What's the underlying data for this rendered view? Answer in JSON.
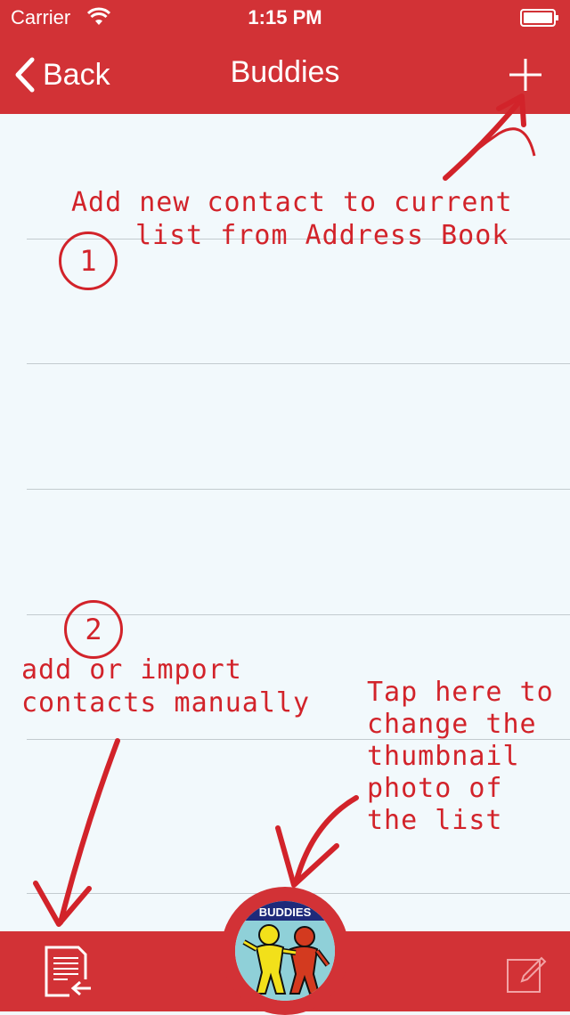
{
  "status_bar": {
    "carrier": "Carrier",
    "time": "1:15 PM"
  },
  "nav": {
    "back_label": "Back",
    "title": "Buddies"
  },
  "annotations": {
    "note1_line1": "Add new contact to current",
    "note1_line2": "list from Address Book",
    "circle1": "1",
    "circle2": "2",
    "note2_line1": "add or import",
    "note2_line2": "contacts manually",
    "note3_line1": "Tap here to",
    "note3_line2": "change the",
    "note3_line3": "thumbnail",
    "note3_line4": "photo of",
    "note3_line5": "the list"
  },
  "thumbnail": {
    "banner_text": "BUDDIES"
  },
  "colors": {
    "accent": "#d23236",
    "annotation": "#d2232a",
    "background": "#f2f9fc",
    "divider": "#c3cbcf"
  },
  "icons": [
    "wifi-icon",
    "battery-icon",
    "back-chevron-icon",
    "plus-icon",
    "import-list-icon",
    "edit-icon"
  ]
}
